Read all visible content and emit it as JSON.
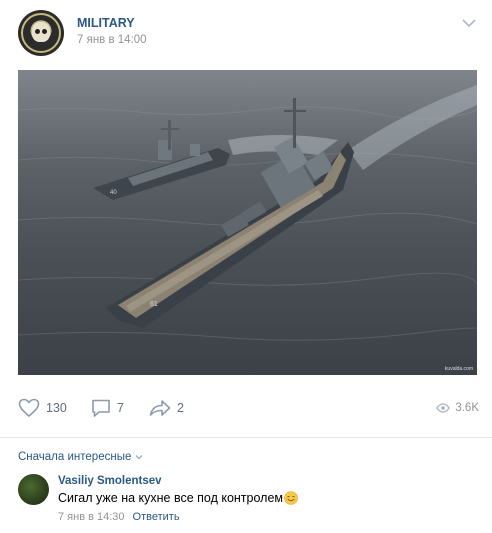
{
  "post": {
    "group_name": "MILITARY",
    "time": "7 янв в 14:00",
    "image_watermark": "kuvalda.com",
    "menu_icon": "chevron-down-icon"
  },
  "actions": {
    "likes": "130",
    "comments": "7",
    "shares": "2",
    "views": "3.6K"
  },
  "comments_section": {
    "sort_label": "Сначала интересные",
    "items": [
      {
        "author": "Vasiliy Smolentsev",
        "text": "Сигал уже на кухне все под контролем",
        "time": "7 янв в 14:30",
        "reply_label": "Ответить"
      }
    ]
  },
  "colors": {
    "link": "#2a5885",
    "meta": "#939393",
    "action": "#626d7a"
  }
}
